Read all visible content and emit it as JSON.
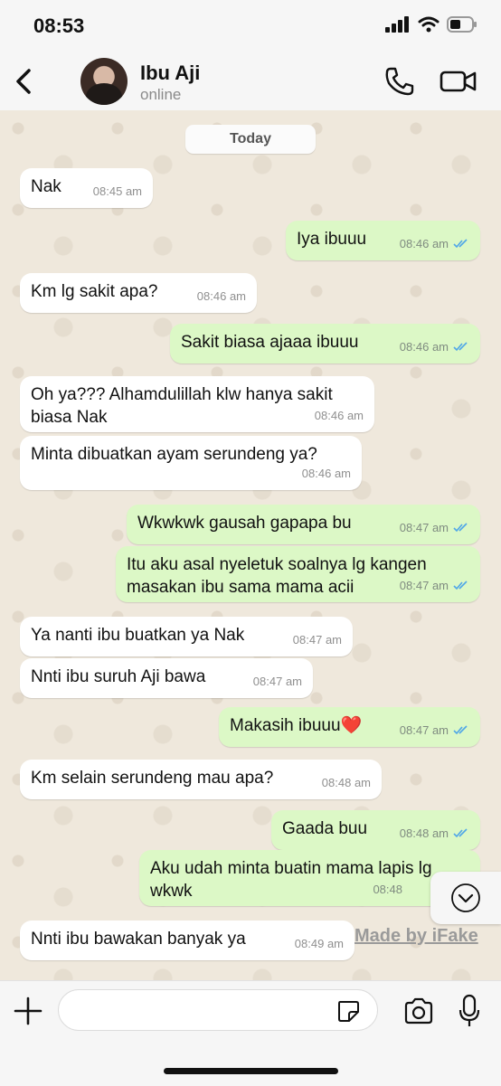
{
  "status_bar": {
    "time": "08:53"
  },
  "header": {
    "contact_name": "Ibu Aji",
    "contact_status": "online"
  },
  "chat": {
    "date_label": "Today",
    "messages": [
      {
        "dir": "in",
        "text": "Nak",
        "time": "08:45 am"
      },
      {
        "dir": "out",
        "text": "Iya ibuuu",
        "time": "08:46 am"
      },
      {
        "dir": "in",
        "text": "Km lg sakit apa?",
        "time": "08:46 am"
      },
      {
        "dir": "out",
        "text": "Sakit biasa ajaaa ibuuu",
        "time": "08:46 am"
      },
      {
        "dir": "in",
        "text": "Oh ya??? Alhamdulillah klw hanya sakit\nbiasa Nak",
        "time": "08:46 am"
      },
      {
        "dir": "in",
        "text": "Minta dibuatkan ayam serundeng ya?",
        "time": "08:46 am"
      },
      {
        "dir": "out",
        "text": "Wkwkwk gausah gapapa bu",
        "time": "08:47 am"
      },
      {
        "dir": "out",
        "text": "Itu aku asal nyeletuk soalnya lg kangen\nmasakan ibu sama mama acii",
        "time": "08:47 am"
      },
      {
        "dir": "in",
        "text": "Ya nanti ibu buatkan ya Nak",
        "time": "08:47 am"
      },
      {
        "dir": "in",
        "text": "Nnti ibu suruh Aji bawa",
        "time": "08:47 am"
      },
      {
        "dir": "out",
        "text": "Makasih ibuuu❤️",
        "time": "08:47 am"
      },
      {
        "dir": "in",
        "text": "Km selain serundeng mau apa?",
        "time": "08:48 am"
      },
      {
        "dir": "out",
        "text": "Gaada buu",
        "time": "08:48 am"
      },
      {
        "dir": "out",
        "text": "Aku udah minta buatin mama lapis lg\nwkwk",
        "time": "08:48"
      },
      {
        "dir": "in",
        "text": "Nnti ibu bawakan banyak ya",
        "time": "08:49 am"
      }
    ]
  },
  "watermark": "Made by iFake",
  "input": {
    "placeholder": ""
  },
  "icons": {
    "back": "chevron-left-icon",
    "call": "phone-icon",
    "video": "video-camera-icon",
    "scroll_down": "chevron-down-icon",
    "plus": "plus-icon",
    "sticker": "sticker-icon",
    "camera": "camera-icon",
    "mic": "microphone-icon"
  },
  "colors": {
    "incoming_bubble": "#ffffff",
    "outgoing_bubble": "#dcf8c6",
    "read_ticks": "#4fa6e8"
  }
}
